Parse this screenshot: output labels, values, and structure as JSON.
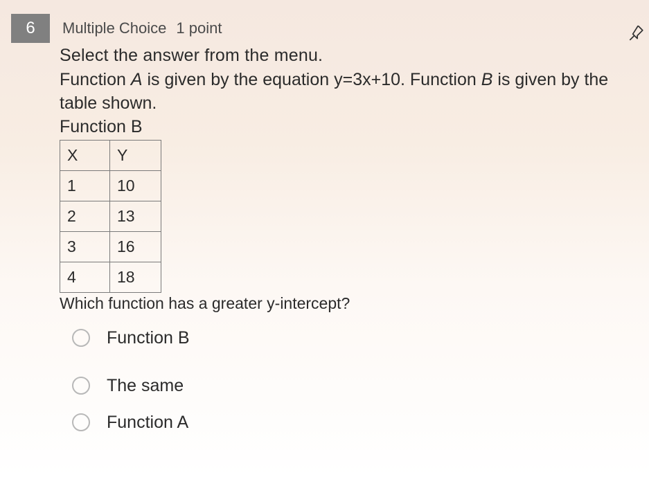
{
  "header": {
    "number": "6",
    "type": "Multiple Choice",
    "points": "1 point"
  },
  "question": {
    "line1": "Select the answer from the menu.",
    "line2_pre": "Function ",
    "line2_a": "A",
    "line2_mid": " is given by the equation y=3x+10. Function ",
    "line2_b": "B",
    "line2_post": " is given by the table shown.",
    "table_label": "Function B",
    "table": {
      "col1": "X",
      "col2": "Y",
      "rows": [
        {
          "x": "1",
          "y": "10"
        },
        {
          "x": "2",
          "y": "13"
        },
        {
          "x": "3",
          "y": "16"
        },
        {
          "x": "4",
          "y": "18"
        }
      ]
    },
    "post_question": "Which function has a greater y-intercept?"
  },
  "options": [
    {
      "label": "Function B"
    },
    {
      "label": "The same"
    },
    {
      "label": "Function A"
    }
  ]
}
